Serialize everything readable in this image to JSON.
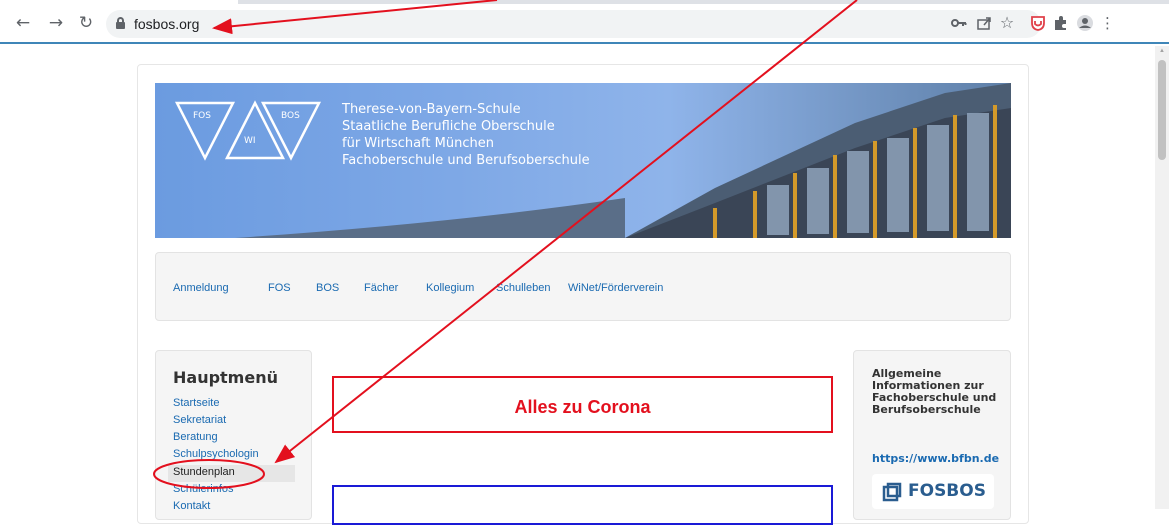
{
  "browser": {
    "url": "fosbos.org",
    "icons": [
      "back-icon",
      "forward-icon",
      "reload-icon",
      "lock-icon",
      "key-icon",
      "share-icon",
      "star-icon",
      "extension-shield-icon",
      "puzzle-icon",
      "profile-icon",
      "menu-icon"
    ]
  },
  "banner": {
    "logo_labels": [
      "FOS",
      "WI",
      "BOS"
    ],
    "lines": [
      "Therese-von-Bayern-Schule",
      "Staatliche Berufliche Oberschule",
      "für Wirtschaft München",
      "Fachoberschule und Berufsoberschule"
    ]
  },
  "nav": {
    "items": [
      "Anmeldung",
      "FOS",
      "BOS",
      "Fächer",
      "Kollegium",
      "Schulleben",
      "WiNet/Förderverein"
    ]
  },
  "sidebar": {
    "title": "Hauptmenü",
    "items": [
      "Startseite",
      "Sekretariat",
      "Beratung",
      "Schulpsychologin",
      "Stundenplan",
      "Schülerinfos",
      "Kontakt"
    ]
  },
  "main": {
    "corona_label": "Alles zu Corona"
  },
  "info": {
    "title": "Allgemeine Informationen zur Fachoberschule und Berufsoberschule",
    "link": "https://www.bfbn.de",
    "logo_text": "FOSBOS"
  },
  "colors": {
    "annotation": "#e3101e",
    "link": "#1a6ab1",
    "blue_box": "#1a1ad6"
  }
}
